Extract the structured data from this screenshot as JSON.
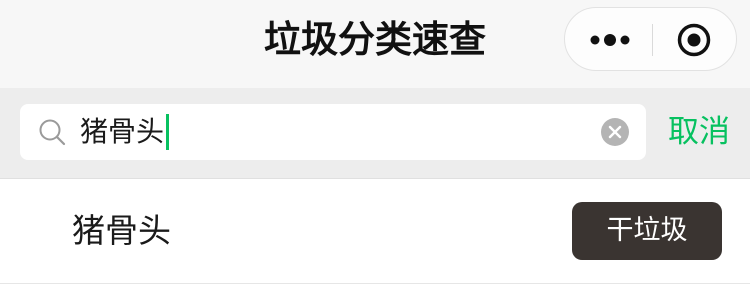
{
  "nav": {
    "title": "垃圾分类速查",
    "more_icon": "more-dots-icon",
    "home_icon": "target-circle-icon"
  },
  "search": {
    "value": "猪骨头",
    "search_icon": "search-icon",
    "clear_icon": "clear-icon",
    "cancel_label": "取消"
  },
  "results": [
    {
      "name": "猪骨头",
      "category": "干垃圾"
    }
  ],
  "colors": {
    "accent": "#07c160",
    "nav_bg": "#f7f7f7",
    "search_bg": "#ededed",
    "badge_bg": "#3a3431"
  }
}
